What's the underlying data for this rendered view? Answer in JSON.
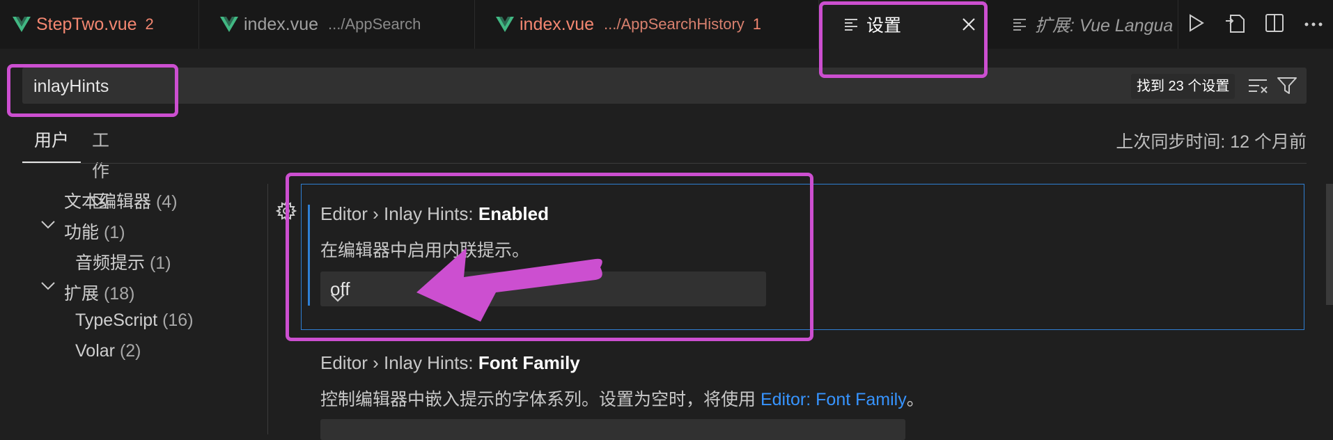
{
  "tabs": [
    {
      "name": "StepTwo.vue",
      "count": "2"
    },
    {
      "name": "index.vue",
      "desc": ".../AppSearch"
    },
    {
      "name": "index.vue",
      "desc": ".../AppSearchHistory",
      "count": "1"
    },
    {
      "name": "设置"
    },
    {
      "name": "扩展: Vue Langua"
    }
  ],
  "search": {
    "value": "inlayHints",
    "found": "找到 23 个设置"
  },
  "subtabs": {
    "user": "用户",
    "workspace": "工作区"
  },
  "sync": "上次同步时间: 12 个月前",
  "tree": [
    {
      "label": "文本编辑器",
      "count": "(4)"
    },
    {
      "label": "功能",
      "count": "(1)"
    },
    {
      "label": "音频提示",
      "count": "(1)"
    },
    {
      "label": "扩展",
      "count": "(18)"
    },
    {
      "label": "TypeScript",
      "count": "(16)"
    },
    {
      "label": "Volar",
      "count": "(2)"
    }
  ],
  "setting1": {
    "prefix": "Editor › Inlay Hints: ",
    "name": "Enabled",
    "desc": "在编辑器中启用内联提示。",
    "value": "off"
  },
  "setting2": {
    "prefix": "Editor › Inlay Hints: ",
    "name": "Font Family",
    "desc": "控制编辑器中嵌入提示的字体系列。设置为空时，将使用 ",
    "link": "Editor: Font Family",
    "desc_end": "。"
  },
  "colors": {
    "accent": "#2f7fd3",
    "highlight": "#cc4fd0",
    "vue": "#41b883"
  },
  "icons": [
    "vue-icon",
    "settings-lines-icon",
    "close-icon",
    "run-icon",
    "open-file-icon",
    "split-editor-icon",
    "more-icon",
    "clear-filter-icon",
    "filter-icon",
    "gear-icon",
    "chevron-down-icon"
  ]
}
